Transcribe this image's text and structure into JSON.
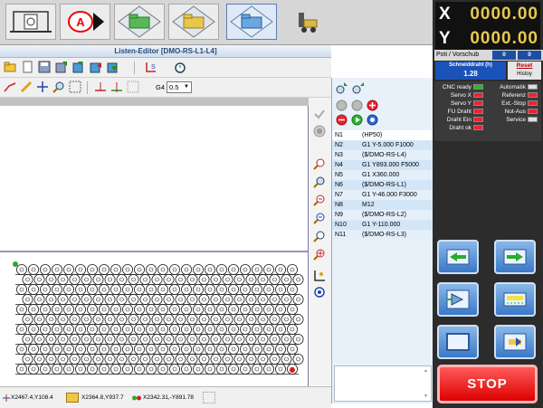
{
  "app": {
    "editor_title": "Listen-Editor [DMO-RS-L1-L4]"
  },
  "toolbar": {
    "feed_label": "G4",
    "feed_value": "0.5"
  },
  "program": {
    "rows": [
      {
        "n": "N1",
        "code": "(HP50)"
      },
      {
        "n": "N2",
        "code": "G1 Y-5.000 F1000"
      },
      {
        "n": "N3",
        "code": "($/DMO-RS-L4)"
      },
      {
        "n": "N4",
        "code": "G1 Y893.000 F5000"
      },
      {
        "n": "N5",
        "code": "G1 X360.000"
      },
      {
        "n": "N6",
        "code": "($/DMO-RS-L1)"
      },
      {
        "n": "N7",
        "code": "G1 Y-46.000 F3000"
      },
      {
        "n": "N8",
        "code": "M12"
      },
      {
        "n": "N9",
        "code": "($/DMO-RS-L2)"
      },
      {
        "n": "N10",
        "code": "G1 Y-110.000"
      },
      {
        "n": "N11",
        "code": "($/DMO-RS-L3)"
      }
    ]
  },
  "statusbar": {
    "coord1": "X2467.4,Y108.4",
    "coord2": "X2364.8,Y937.7",
    "coord3": "X2342.31,-Y891.78"
  },
  "dro": {
    "x_axis": "X",
    "x_value": "0000.00",
    "y_axis": "Y",
    "y_value": "0000.00"
  },
  "poti": {
    "label": "Poti / Vorschub",
    "val1": "0",
    "val2": "0"
  },
  "schneiddraht": {
    "label": "Schneiddraht (h)",
    "value": "1.28"
  },
  "reset": {
    "reset_label": "Reset",
    "history_label": "Histoy"
  },
  "status": {
    "left": [
      {
        "label": "CNC ready",
        "lamp": "green"
      },
      {
        "label": "Servo X",
        "lamp": "red"
      },
      {
        "label": "Servo Y",
        "lamp": "red"
      },
      {
        "label": "FU Draht",
        "lamp": "red"
      },
      {
        "label": "Draht Ein",
        "lamp": "red"
      },
      {
        "label": "Draht ok",
        "lamp": "red"
      }
    ],
    "right": [
      {
        "label": "Automatik",
        "lamp": "white"
      },
      {
        "label": "Referenz",
        "lamp": "red"
      },
      {
        "label": "Ext.-Stop",
        "lamp": "red"
      },
      {
        "label": "Not-Aus",
        "lamp": "red"
      },
      {
        "label": "Service",
        "lamp": "white"
      }
    ]
  },
  "stop": {
    "label": "STOP"
  },
  "colors": {
    "dro_value": "#e7c84e",
    "stop_red": "#dd0000",
    "schneid_blue": "#1a52b8",
    "list_bg": "#e8f1fa"
  }
}
